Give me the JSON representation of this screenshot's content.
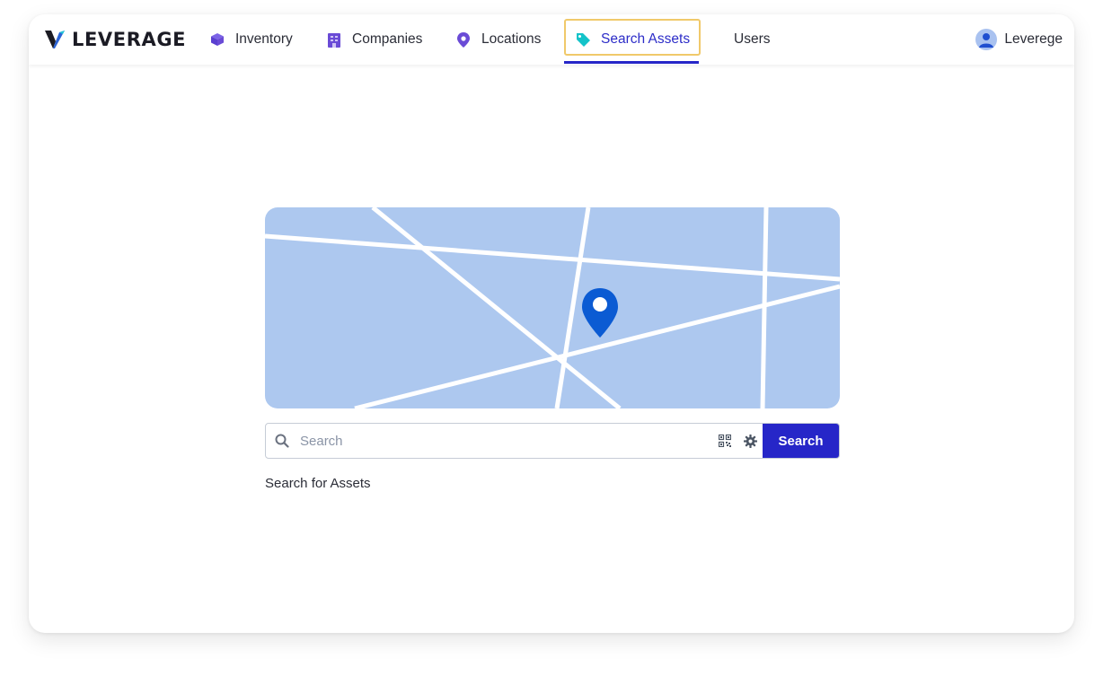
{
  "brand": {
    "name": "LEVERAGE"
  },
  "nav": {
    "items": [
      {
        "label": "Inventory",
        "icon": "cube-icon"
      },
      {
        "label": "Companies",
        "icon": "building-icon"
      },
      {
        "label": "Locations",
        "icon": "map-pin-icon"
      },
      {
        "label": "Search Assets",
        "icon": "tag-icon",
        "active": true
      },
      {
        "label": "Users"
      }
    ]
  },
  "user": {
    "name": "Leverege",
    "icon": "user-avatar-icon"
  },
  "search": {
    "placeholder": "Search",
    "value": "",
    "button_label": "Search",
    "aux_icons": [
      "qr-code-icon",
      "gear-icon"
    ]
  },
  "caption": "Search for Assets",
  "colors": {
    "accent": "#2626c8",
    "active_highlight": "#f0c96a",
    "map_background": "#adc8ef",
    "map_pin": "#0b5bd3",
    "nav_icon": "#6a4bd6",
    "tag_icon": "#14c3c9"
  }
}
